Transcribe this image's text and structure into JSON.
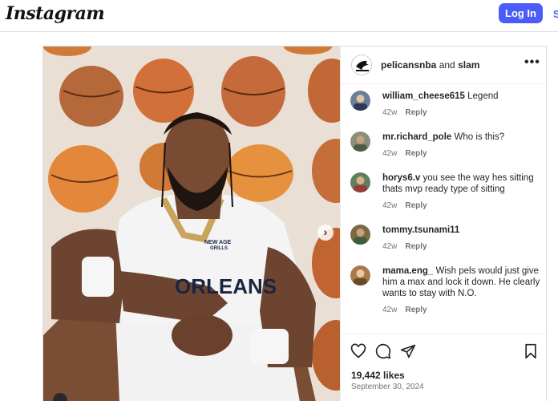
{
  "nav": {
    "logo": "Instagram",
    "login_label": "Log In",
    "signup_label": "S"
  },
  "post": {
    "author": "pelicansnba",
    "and_text": "and",
    "collaborator": "slam",
    "comments": [
      {
        "user": "william_cheese615",
        "text": "Legend",
        "age": "42w",
        "reply": "Reply"
      },
      {
        "user": "mr.richard_pole",
        "text": "Who is this?",
        "age": "42w",
        "reply": "Reply"
      },
      {
        "user": "horys6.v",
        "text": "you see the way hes sitting thats mvp ready type of sitting",
        "age": "42w",
        "reply": "Reply"
      },
      {
        "user": "tommy.tsunami11",
        "text": "",
        "age": "42w",
        "reply": "Reply"
      },
      {
        "user": "mama.eng_",
        "text": "Wish pels would just give him a max and lock it down. He clearly wants to stay with N.O.",
        "age": "42w",
        "reply": "Reply"
      }
    ],
    "likes": "19,442 likes",
    "date": "September 30, 2024",
    "jersey_brand": "NEW AGE",
    "jersey_sponsor": "GRILLS",
    "jersey_text": "ORLEANS",
    "colors": {
      "brand_button": "#4a5df9",
      "jersey_white": "#f4f4f4",
      "jersey_gold": "#c8a45d",
      "ball_orange": "#d9772b"
    }
  }
}
